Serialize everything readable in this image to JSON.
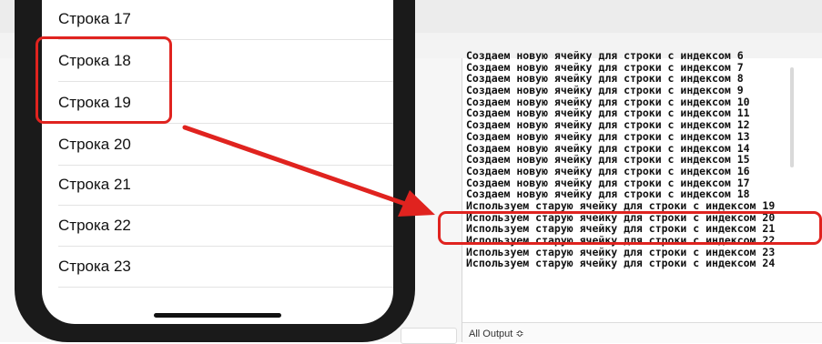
{
  "phone": {
    "rows": [
      {
        "label": "Строка 17"
      },
      {
        "label": "Строка 18"
      },
      {
        "label": "Строка 19"
      },
      {
        "label": "Строка 20"
      },
      {
        "label": "Строка 21"
      },
      {
        "label": "Строка 22"
      },
      {
        "label": "Строка 23"
      }
    ]
  },
  "console": {
    "lines": [
      "Создаем новую ячейку для строки с индексом 6",
      "Создаем новую ячейку для строки с индексом 7",
      "Создаем новую ячейку для строки с индексом 8",
      "Создаем новую ячейку для строки с индексом 9",
      "Создаем новую ячейку для строки с индексом 10",
      "Создаем новую ячейку для строки с индексом 11",
      "Создаем новую ячейку для строки с индексом 12",
      "Создаем новую ячейку для строки с индексом 13",
      "Создаем новую ячейку для строки с индексом 14",
      "Создаем новую ячейку для строки с индексом 15",
      "Создаем новую ячейку для строки с индексом 16",
      "Создаем новую ячейку для строки с индексом 17",
      "Создаем новую ячейку для строки с индексом 18",
      "Используем старую ячейку для строки с индексом 19",
      "Используем старую ячейку для строки с индексом 20",
      "Используем старую ячейку для строки с индексом 21",
      "Используем старую ячейку для строки с индексом 22",
      "Используем старую ячейку для строки с индексом 23",
      "Используем старую ячейку для строки с индексом 24"
    ],
    "filter_label": "All Output ≎"
  },
  "colors": {
    "highlight": "#e0231f",
    "phone_bezel": "#1a1a1a"
  }
}
